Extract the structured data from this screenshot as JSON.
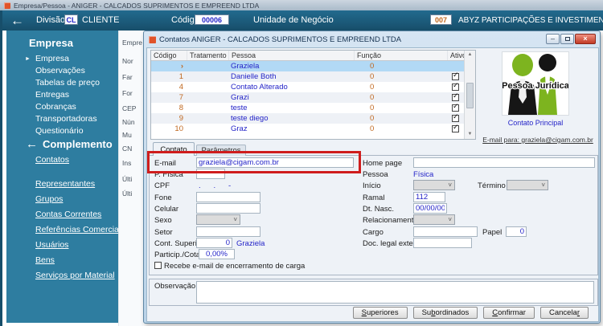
{
  "window": {
    "title": "Empresa/Pessoa - ANIGER - CALCADOS SUPRIMENTOS E EMPREEND LTDA"
  },
  "navbar": {
    "division_label": "Divisão",
    "division_code": "CL",
    "division_name": "CLIENTE",
    "code_label": "Código",
    "code_value": "00006",
    "unit_label": "Unidade de Negócio",
    "unit_code": "007",
    "unit_name": "ABYZ PARTICIPAÇÕES E INVESTIMENTOS"
  },
  "sidebar": {
    "section_empresa": {
      "title": "Empresa",
      "items": [
        "Empresa",
        "Observações",
        "Tabelas de preço",
        "Entregas",
        "Cobranças",
        "Transportadoras",
        "Questionário"
      ]
    },
    "section_complemento": {
      "title": "Complemento",
      "active_link": "Contatos",
      "links": [
        "Representantes",
        "Grupos",
        "Contas Correntes",
        "Referências Comerciais",
        "Usuários",
        "Bens",
        "Serviços por Material"
      ]
    }
  },
  "background_form": {
    "labels": [
      "Empre",
      "Nor",
      "Far",
      "For",
      "CEP",
      "Nún",
      "Mu",
      "CN",
      "Ins",
      "Últi",
      "Últi"
    ]
  },
  "dialog": {
    "title": "Contatos ANIGER - CALCADOS SUPRIMENTOS E EMPREEND LTDA",
    "grid": {
      "columns": [
        "Código",
        "Tratamento",
        "Pessoa",
        "Função",
        "Ativo"
      ],
      "rows": [
        {
          "codigo": "",
          "tratamento": "",
          "pessoa": "Graziela",
          "funcao": "0",
          "ativo": false,
          "marker": "›"
        },
        {
          "codigo": "1",
          "tratamento": "",
          "pessoa": "Danielle Both",
          "funcao": "0",
          "ativo": true
        },
        {
          "codigo": "4",
          "tratamento": "",
          "pessoa": "Contato Alterado",
          "funcao": "0",
          "ativo": true
        },
        {
          "codigo": "7",
          "tratamento": "",
          "pessoa": "Grazi",
          "funcao": "0",
          "ativo": true
        },
        {
          "codigo": "8",
          "tratamento": "",
          "pessoa": "teste",
          "funcao": "0",
          "ativo": true
        },
        {
          "codigo": "9",
          "tratamento": "",
          "pessoa": "teste diego",
          "funcao": "0",
          "ativo": true
        },
        {
          "codigo": "10",
          "tratamento": "",
          "pessoa": "Graz",
          "funcao": "0",
          "ativo": true
        }
      ]
    },
    "side_panel": {
      "image_caption": "Pessoa Jurídica",
      "primary_contact_link": "Contato Principal",
      "email_link": "E-mail para: graziela@cigam.com.br"
    },
    "tabs": [
      {
        "label": "Contato",
        "active": true
      },
      {
        "label": "Parâmetros",
        "active": false
      }
    ],
    "form": {
      "email": {
        "label": "E-mail",
        "value": "graziela@cigam.com.br"
      },
      "home_page": {
        "label": "Home page",
        "value": ""
      },
      "p_fisica": {
        "label": "P. Física",
        "value": ""
      },
      "pessoa": {
        "label": "Pessoa",
        "value": "Física"
      },
      "cpf": {
        "label": "CPF",
        "value": ".      .      -"
      },
      "inicio": {
        "label": "Início",
        "value": ""
      },
      "termino": {
        "label": "Término",
        "value": ""
      },
      "fone": {
        "label": "Fone",
        "value": ""
      },
      "ramal": {
        "label": "Ramal",
        "value": "112"
      },
      "celular": {
        "label": "Celular",
        "value": ""
      },
      "dt_nasc": {
        "label": "Dt. Nasc.",
        "value": "00/00/00"
      },
      "sexo": {
        "label": "Sexo",
        "value": ""
      },
      "relacionamento": {
        "label": "Relacionamento",
        "value": ""
      },
      "setor": {
        "label": "Setor",
        "value": ""
      },
      "cargo": {
        "label": "Cargo",
        "value": ""
      },
      "papel": {
        "label": "Papel",
        "value": "0"
      },
      "cont_superior": {
        "label": "Cont. Superior",
        "value": "0",
        "display_name": "Graziela"
      },
      "doc_legal": {
        "label": "Doc. legal exterior",
        "value": ""
      },
      "particip": {
        "label": "Particip./Cotas",
        "value": "0,00%"
      },
      "recebe_email_checkbox": {
        "label": "Recebe e-mail de encerramento de carga",
        "checked": false
      },
      "observacao": {
        "label": "Observação",
        "value": ""
      }
    },
    "buttons": {
      "superiores": {
        "pre": "",
        "key": "S",
        "post": "uperiores"
      },
      "subordinados": {
        "pre": "Su",
        "key": "b",
        "post": "ordinados"
      },
      "confirmar": {
        "pre": "",
        "key": "C",
        "post": "onfirmar"
      },
      "cancelar": {
        "pre": "Cancela",
        "key": "r",
        "post": ""
      }
    }
  },
  "icons": {
    "back_arrow": "←",
    "item_marker": "►",
    "section_arrow": "←",
    "chevron_down": "˅",
    "scroll_up": "▲",
    "scroll_down": "▼",
    "check": "✓",
    "minimize": "–",
    "close": "×"
  },
  "colors": {
    "navbar_teal": "#1b5874",
    "sidebar_teal": "#2e7da0",
    "selected_row_blue": "#b2d9f5",
    "annotation_red": "#cf1d1d",
    "value_blue": "#2424c8",
    "value_orange": "#c0671e",
    "figure_green": "#7db41f"
  }
}
